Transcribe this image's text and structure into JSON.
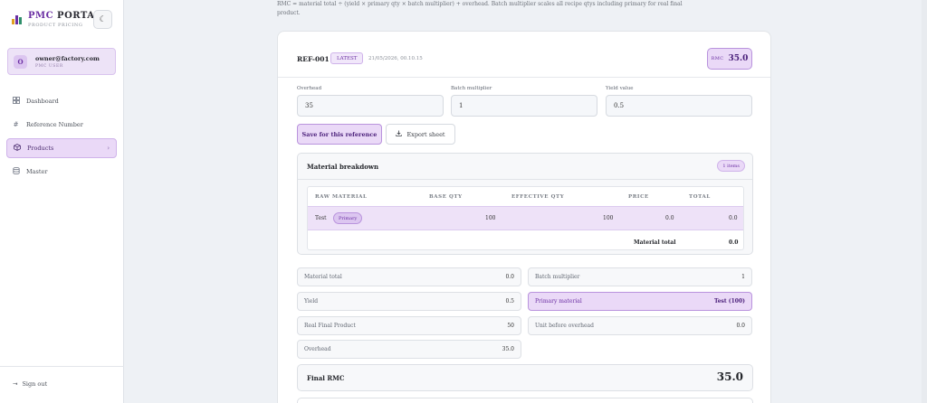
{
  "brand": {
    "title_part1": "PMC",
    "title_part2": "PORTAL",
    "subtitle": "PRODUCT PRICING"
  },
  "user": {
    "email": "owner@factory.com",
    "role": "PMC USER",
    "avatar": "O"
  },
  "sidebar": {
    "items": [
      {
        "label": "Dashboard",
        "icon": "grid-icon"
      },
      {
        "label": "Reference Number",
        "icon": "hash-icon"
      },
      {
        "label": "Products",
        "icon": "box-icon",
        "active": true
      },
      {
        "label": "Master",
        "icon": "database-icon"
      }
    ],
    "signout": "Sign out"
  },
  "top_note": "RMC = material total ÷ (yield × primary qty × batch multiplier) + overhead. Batch multiplier scales all recipe qtys including primary for real final product.",
  "reference": {
    "id": "REF-001",
    "badge": "LATEST",
    "date": "21/05/2026, 00.10.15",
    "rmc_label": "RMC",
    "rmc_value": "35.0"
  },
  "fields": {
    "overhead": {
      "label": "Overhead",
      "value": "35"
    },
    "batch_multiplier": {
      "label": "Batch multiplier",
      "value": "1"
    },
    "yield_value": {
      "label": "Yield value",
      "value": "0.5"
    }
  },
  "actions": {
    "save": "Save for this reference",
    "export": "Export sheet"
  },
  "material_breakdown": {
    "title": "Material breakdown",
    "count": "1 items",
    "headers": [
      "RAW MATERIAL",
      "BASE QTY",
      "EFFECTIVE QTY",
      "PRICE",
      "TOTAL"
    ],
    "rows": [
      {
        "material": "Test",
        "tag": "Primary",
        "base_qty": "100",
        "effective_qty": "100",
        "price": "0.0",
        "total": "0.0"
      }
    ],
    "total_label": "Material total",
    "total_value": "0.0"
  },
  "summary": {
    "material_total": {
      "label": "Material total",
      "value": "0.0"
    },
    "batch_multiplier": {
      "label": "Batch multiplier",
      "value": "1"
    },
    "yield": {
      "label": "Yield",
      "value": "0.5"
    },
    "primary_material": {
      "label": "Primary material",
      "value": "Test (100)"
    },
    "real_final_product": {
      "label": "Real Final Product",
      "value": "50"
    },
    "unit_before_overhead": {
      "label": "Unit before overhead",
      "value": "0.0"
    },
    "overhead": {
      "label": "Overhead",
      "value": "35.0"
    }
  },
  "final": {
    "label": "Final RMC",
    "value": "35.0"
  },
  "colors": {
    "accent": "#6b2fa3",
    "accent_bg": "#ead9f7"
  }
}
